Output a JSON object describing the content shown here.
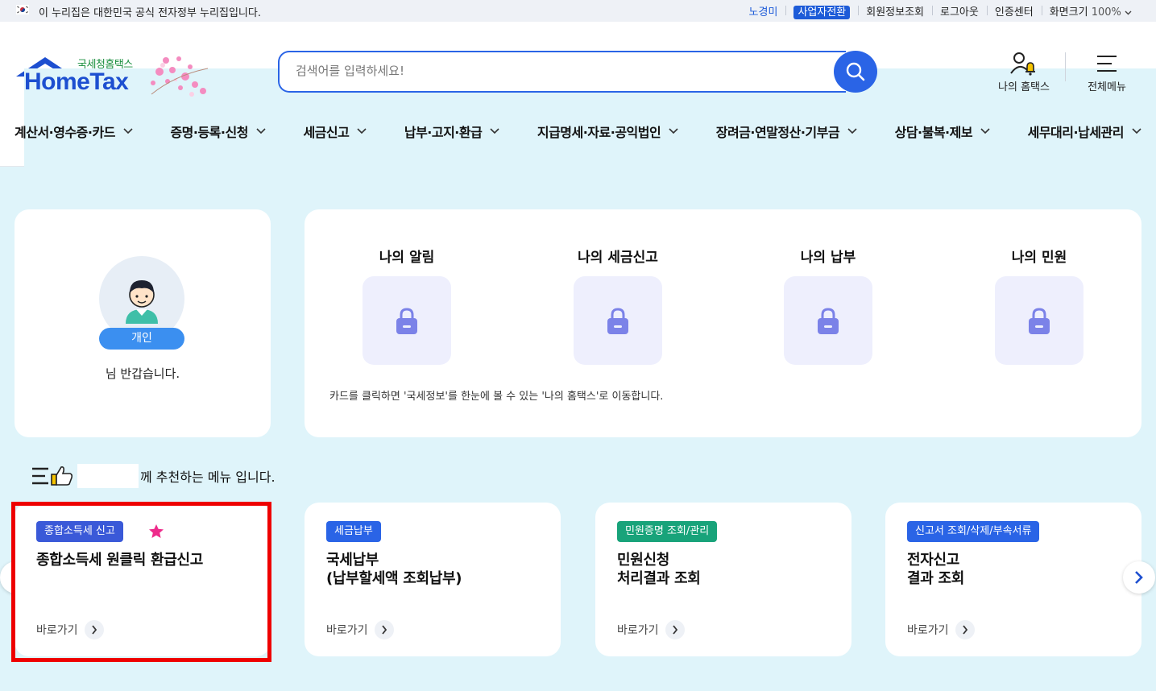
{
  "topbar": {
    "notice": "이 누리집은 대한민국 공식 전자정부 누리집입니다.",
    "user": "노경미",
    "business_switch": "사업자전환",
    "member_info": "회원정보조회",
    "logout": "로그아웃",
    "cert_center": "인증센터",
    "zoom_label": "화면크기",
    "zoom_value": "100%"
  },
  "header": {
    "logo_sub": "국세청홈택스",
    "logo_main": "HomeTax",
    "search_placeholder": "검색어를 입력하세요!",
    "my_hometax": "나의 홈택스",
    "all_menu": "전체메뉴"
  },
  "gnb": [
    "계산서·영수증·카드",
    "증명·등록·신청",
    "세금신고",
    "납부·고지·환급",
    "지급명세·자료·공익법인",
    "장려금·연말정산·기부금",
    "상담·불복·제보",
    "세무대리·납세관리"
  ],
  "profile": {
    "tag": "개인",
    "greeting": "님 반갑습니다."
  },
  "my_cards": {
    "items": [
      "나의 알림",
      "나의 세금신고",
      "나의 납부",
      "나의 민원"
    ],
    "hint": "카드를 클릭하면 '국세정보'를 한눈에 볼 수 있는 '나의 홈택스'로 이동합니다."
  },
  "recommend": {
    "title_suffix": "께 추천하는 메뉴 입니다.",
    "go_label": "바로가기",
    "cards": [
      {
        "category": "종합소득세 신고",
        "name": "종합소득세 원클릭 환급신고",
        "color": "#3a59d8"
      },
      {
        "category": "세금납부",
        "name": "국세납부\n(납부할세액 조회납부)",
        "color": "#2a64e6"
      },
      {
        "category": "민원증명 조회/관리",
        "name": "민원신청\n처리결과 조회",
        "color": "#18a37a"
      },
      {
        "category": "신고서 조회/삭제/부속서류",
        "name": "전자신고\n결과 조회",
        "color": "#2a64e6"
      }
    ]
  }
}
